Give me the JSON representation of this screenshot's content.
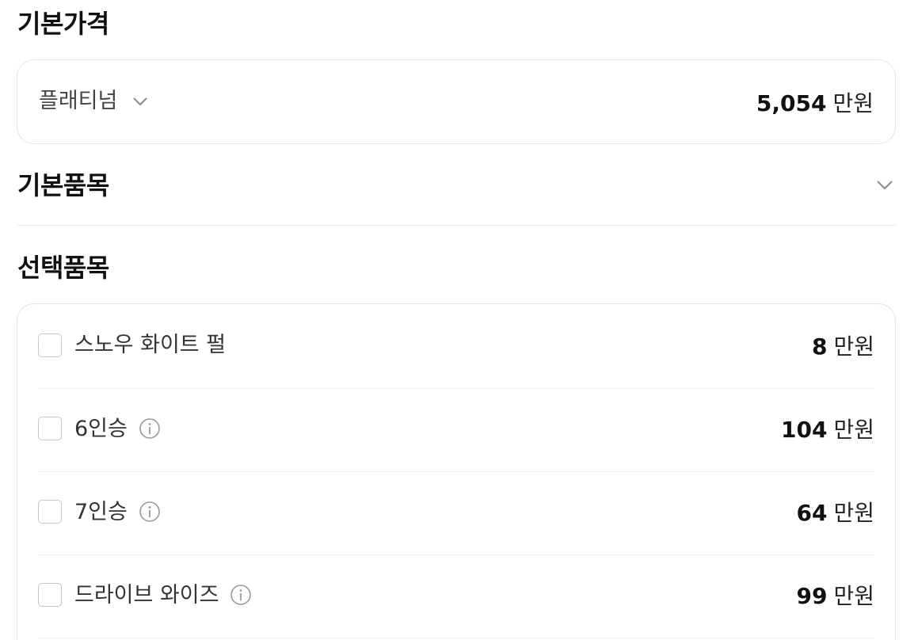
{
  "base_price": {
    "title": "기본가격",
    "trim": {
      "name": "플래티넘",
      "price_value": "5,054",
      "price_unit": "만원"
    }
  },
  "basic_items": {
    "title": "기본품목"
  },
  "options": {
    "title": "선택품목",
    "items": [
      {
        "label": "스노우 화이트 펄",
        "price_value": "8",
        "price_unit": "만원",
        "has_info": false
      },
      {
        "label": "6인승",
        "price_value": "104",
        "price_unit": "만원",
        "has_info": true
      },
      {
        "label": "7인승",
        "price_value": "64",
        "price_unit": "만원",
        "has_info": true
      },
      {
        "label": "드라이브 와이즈",
        "price_value": "99",
        "price_unit": "만원",
        "has_info": true
      }
    ]
  },
  "icons": {
    "trim_dropdown": "chevron-down-icon",
    "basic_items_toggle": "chevron-down-icon",
    "option_info": "info-circle-icon"
  },
  "colors": {
    "text_primary": "#111111",
    "text_secondary": "#444444",
    "border": "#e6e6e6",
    "icon_gray": "#9a9a9a"
  }
}
